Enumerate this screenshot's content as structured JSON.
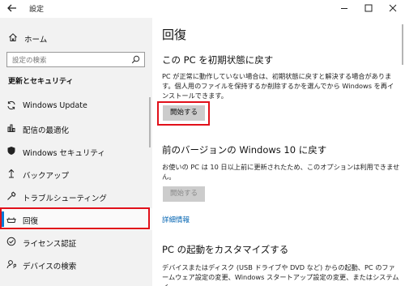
{
  "window": {
    "title": "設定"
  },
  "sidebar": {
    "home_label": "ホーム",
    "search_placeholder": "設定の検索",
    "section_heading": "更新とセキュリティ",
    "items": [
      {
        "label": "Windows Update",
        "icon": "sync-icon"
      },
      {
        "label": "配信の最適化",
        "icon": "delivery-optimization-icon"
      },
      {
        "label": "Windows セキュリティ",
        "icon": "shield-icon"
      },
      {
        "label": "バックアップ",
        "icon": "backup-arrow-icon"
      },
      {
        "label": "トラブルシューティング",
        "icon": "wrench-icon"
      },
      {
        "label": "回復",
        "icon": "recovery-icon",
        "selected": true
      },
      {
        "label": "ライセンス認証",
        "icon": "check-circle-icon"
      },
      {
        "label": "デバイスの検索",
        "icon": "person-location-icon"
      }
    ]
  },
  "main": {
    "title": "回復",
    "reset": {
      "heading": "この PC を初期状態に戻す",
      "description": "PC が正常に動作していない場合は、初期状態に戻すと解決する場合があります。個人用のファイルを保持するか削除するかを選んでから Windows を再インストールできます。",
      "button": "開始する"
    },
    "rollback": {
      "heading": "前のバージョンの Windows 10 に戻す",
      "description": "お使いの PC は 10 日以上前に更新されたため、このオプションは利用できません。",
      "button": "開始する"
    },
    "more_info_link": "詳細情報",
    "advanced": {
      "heading": "PC の起動をカスタマイズする",
      "description": "デバイスまたはディスク (USB ドライブや DVD など) からの起動、PC のファームウェア設定の変更、Windows スタートアップ設定の変更、またはシステム イ"
    }
  },
  "colors": {
    "accent": "#0078d7",
    "highlight": "#e1101a",
    "link": "#0063b1"
  }
}
